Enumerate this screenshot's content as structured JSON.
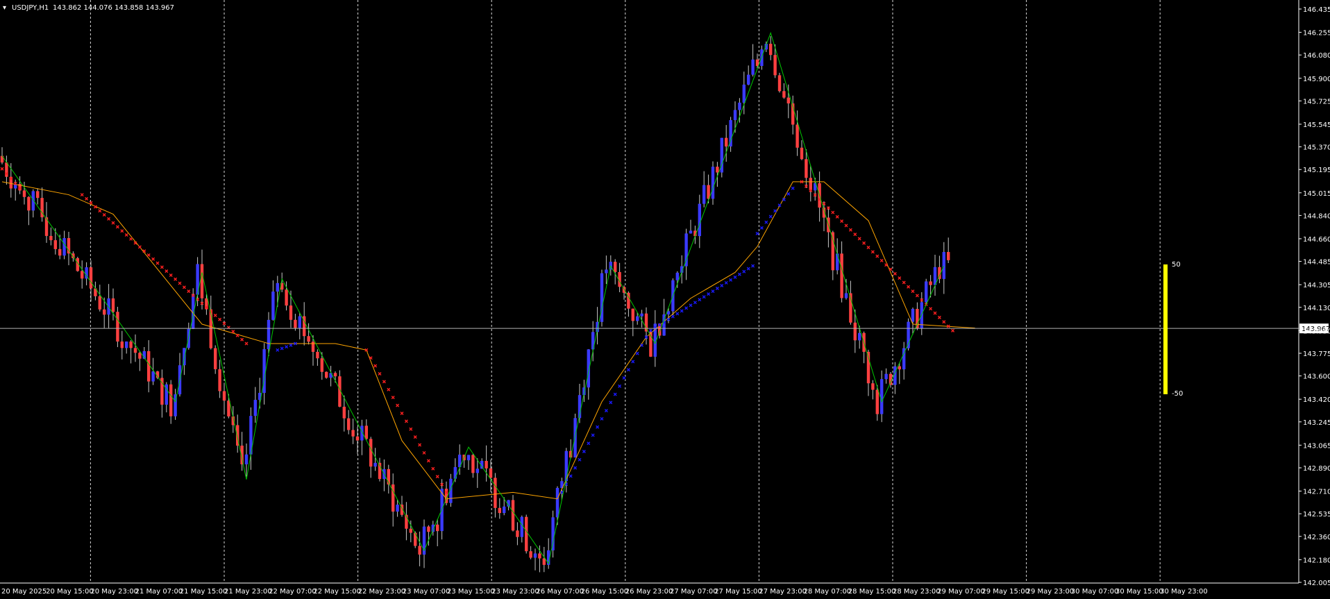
{
  "header": {
    "menu_glyph": "▾",
    "symbol": "USDJPY,H1",
    "ohlc": "143.862 144.076 143.858 143.967"
  },
  "colors": {
    "background": "#000000",
    "bull_candle": "#3a3aff",
    "bear_candle": "#ff4040",
    "wick": "#c8c8c8",
    "zigzag": "#00c800",
    "ma_line": "#ffa500",
    "trail_bear": "#ff2020",
    "trail_bull": "#1a1aff",
    "grid_vertical": "#ffffff",
    "bid_line": "#b4b4b4",
    "strength_bar": "#ffff00",
    "text": "#ffffff"
  },
  "chart_data": {
    "type": "candlestick",
    "symbol": "USDJPY",
    "timeframe": "H1",
    "ylim": [
      142.005,
      146.435
    ],
    "y_ticks": [
      "146.435",
      "146.255",
      "146.080",
      "145.900",
      "145.725",
      "145.545",
      "145.370",
      "145.195",
      "145.015",
      "144.840",
      "144.660",
      "144.485",
      "144.305",
      "144.130",
      "143.950",
      "143.775",
      "143.600",
      "143.420",
      "143.245",
      "143.065",
      "142.890",
      "142.710",
      "142.535",
      "142.360",
      "142.180",
      "142.005"
    ],
    "current_price": "143.967",
    "x_ticks": [
      "20 May 2025",
      "20 May 15:00",
      "20 May 23:00",
      "21 May 07:00",
      "21 May 15:00",
      "21 May 23:00",
      "22 May 07:00",
      "22 May 15:00",
      "22 May 23:00",
      "23 May 07:00",
      "23 May 15:00",
      "23 May 23:00",
      "26 May 07:00",
      "26 May 15:00",
      "26 May 23:00",
      "27 May 07:00",
      "27 May 15:00",
      "27 May 23:00",
      "28 May 07:00",
      "28 May 15:00",
      "28 May 23:00",
      "29 May 07:00",
      "29 May 15:00",
      "29 May 23:00",
      "30 May 07:00",
      "30 May 15:00",
      "30 May 23:00"
    ],
    "day_separators": [
      "20 May 23:00",
      "21 May 23:00",
      "22 May 23:00",
      "23 May 23:00",
      "26 May 23:00",
      "27 May 23:00",
      "28 May 23:00",
      "29 May 23:00",
      "30 May 23:00"
    ],
    "zigzag": [
      {
        "bar": 0,
        "price": 145.3
      },
      {
        "bar": 39,
        "price": 143.4
      },
      {
        "bar": 45,
        "price": 144.4
      },
      {
        "bar": 55,
        "price": 142.8
      },
      {
        "bar": 63,
        "price": 144.35
      },
      {
        "bar": 95,
        "price": 142.25
      },
      {
        "bar": 105,
        "price": 143.05
      },
      {
        "bar": 123,
        "price": 142.15
      },
      {
        "bar": 137,
        "price": 144.45
      },
      {
        "bar": 147,
        "price": 143.85
      },
      {
        "bar": 173,
        "price": 146.25
      },
      {
        "bar": 198,
        "price": 143.4
      },
      {
        "bar": 212,
        "price": 144.45
      }
    ],
    "ma": [
      {
        "bar": 0,
        "price": 145.1
      },
      {
        "bar": 15,
        "price": 145.0
      },
      {
        "bar": 25,
        "price": 144.85
      },
      {
        "bar": 45,
        "price": 144.0
      },
      {
        "bar": 60,
        "price": 143.85
      },
      {
        "bar": 75,
        "price": 143.85
      },
      {
        "bar": 82,
        "price": 143.8
      },
      {
        "bar": 90,
        "price": 143.1
      },
      {
        "bar": 100,
        "price": 142.65
      },
      {
        "bar": 115,
        "price": 142.7
      },
      {
        "bar": 125,
        "price": 142.65
      },
      {
        "bar": 135,
        "price": 143.4
      },
      {
        "bar": 145,
        "price": 143.9
      },
      {
        "bar": 155,
        "price": 144.2
      },
      {
        "bar": 165,
        "price": 144.4
      },
      {
        "bar": 170,
        "price": 144.6
      },
      {
        "bar": 178,
        "price": 145.1
      },
      {
        "bar": 185,
        "price": 145.1
      },
      {
        "bar": 195,
        "price": 144.8
      },
      {
        "bar": 205,
        "price": 144.0
      },
      {
        "bar": 219,
        "price": 143.97
      }
    ],
    "trail_bear": [
      {
        "from": 0,
        "to": 4,
        "start": 145.2,
        "end": 145.05
      },
      {
        "from": 18,
        "to": 55,
        "start": 145.0,
        "end": 143.85
      },
      {
        "from": 82,
        "to": 100,
        "start": 143.8,
        "end": 142.7
      },
      {
        "from": 180,
        "to": 214,
        "start": 145.1,
        "end": 143.95
      }
    ],
    "trail_bull": [
      {
        "from": 62,
        "to": 66,
        "start": 143.8,
        "end": 143.85
      },
      {
        "from": 126,
        "to": 145,
        "start": 142.7,
        "end": 143.9
      },
      {
        "from": 146,
        "to": 169,
        "start": 143.95,
        "end": 144.45
      },
      {
        "from": 170,
        "to": 178,
        "start": 144.7,
        "end": 145.05
      }
    ],
    "strength_bar": {
      "top_label": "50",
      "bottom_label": "-50"
    }
  }
}
